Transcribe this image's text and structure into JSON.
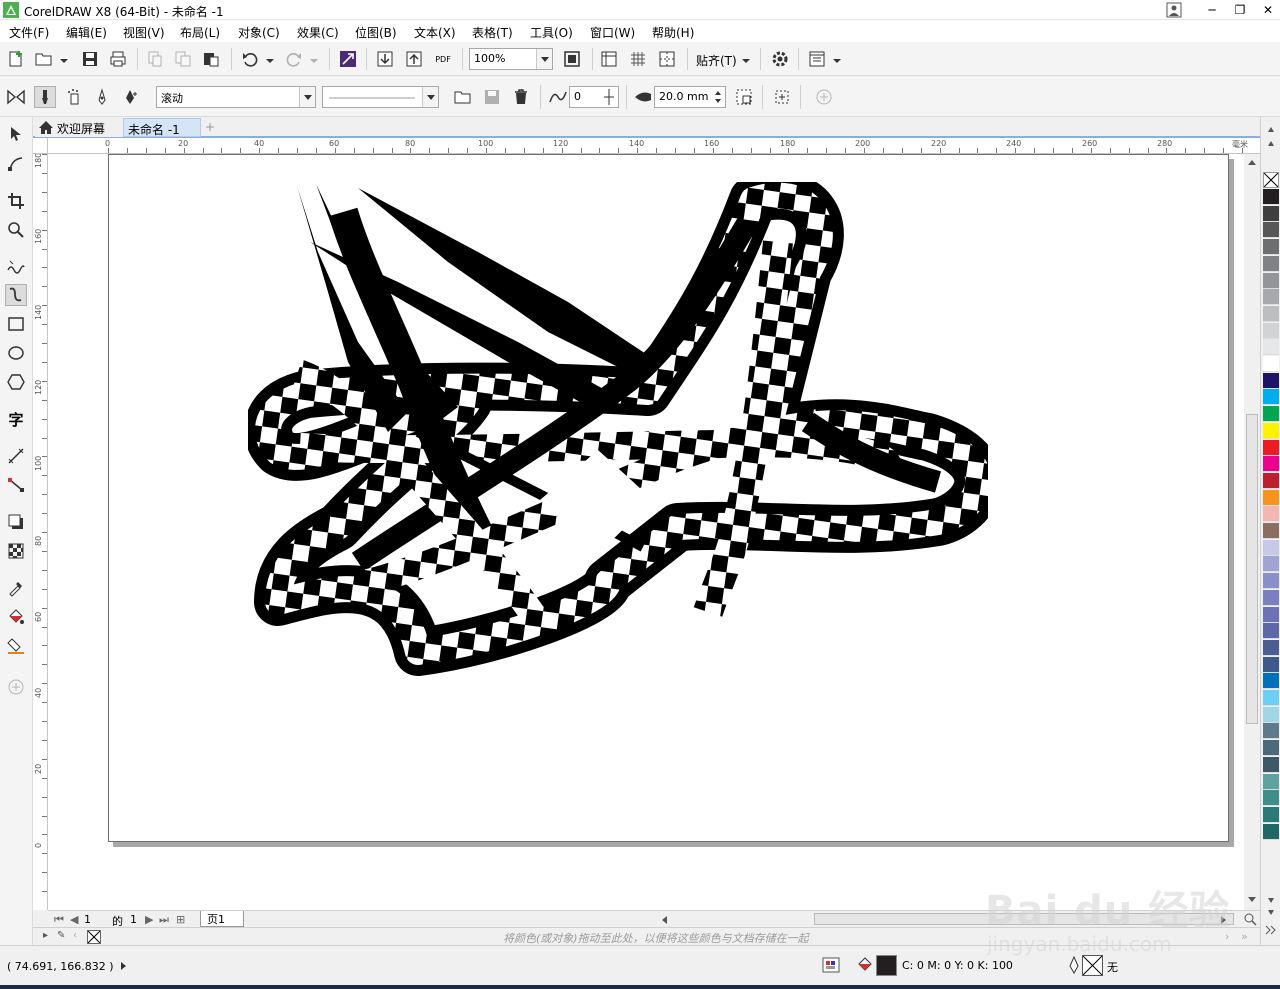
{
  "window": {
    "title": "CorelDRAW X8 (64-Bit) - 未命名 -1",
    "controls": {
      "minimize": "─",
      "restore": "❐",
      "close": "✕"
    }
  },
  "menubar": {
    "items": [
      "文件(F)",
      "编辑(E)",
      "视图(V)",
      "布局(L)",
      "对象(C)",
      "效果(C)",
      "位图(B)",
      "文本(X)",
      "表格(T)",
      "工具(O)",
      "窗口(W)",
      "帮助(H)"
    ]
  },
  "standard_toolbar": {
    "zoom_value": "100%",
    "snap_label": "贴齐(T)",
    "pdf_label": "PDF"
  },
  "property_bar": {
    "brush_type": "滚动",
    "stroke_preset": "",
    "smoothing_value": "0",
    "nib_size": "20.0 mm"
  },
  "tabs": {
    "welcome": "欢迎屏幕",
    "document": "未命名 -1",
    "add": "+"
  },
  "rulers": {
    "unit": "毫米",
    "h_labels": [
      "0",
      "20",
      "40",
      "60",
      "80",
      "100",
      "120",
      "140",
      "160",
      "180",
      "200",
      "220",
      "240",
      "260",
      "280"
    ],
    "v_labels": [
      "180",
      "160",
      "140",
      "120",
      "100",
      "80",
      "60",
      "40",
      "20",
      "0"
    ]
  },
  "page_nav": {
    "current": "1",
    "of_label": "的",
    "total": "1",
    "page_tab": "页1"
  },
  "document_palette": {
    "hint": "将颜色(或对象)拖动至此处，以便将这些颜色与文档存储在一起"
  },
  "palette": {
    "colors": [
      "#231f20",
      "#3f3f3f",
      "#575757",
      "#6d6e70",
      "#808285",
      "#939598",
      "#a7a9ac",
      "#bcbec0",
      "#d1d3d4",
      "#e6e7e8",
      "#ffffff",
      "#1b1464",
      "#00aeef",
      "#00a651",
      "#fff200",
      "#ed1c24",
      "#ec008c",
      "#be1e2d",
      "#f7941d",
      "#f4b6b1",
      "#8b6d62",
      "#c7c9e6",
      "#9fa4d4",
      "#8a8fc9",
      "#7a7fbf",
      "#6d72b4",
      "#5d68a8",
      "#4b5e93",
      "#3c5a8b",
      "#0072bc",
      "#6dcff6",
      "#a0d6e6",
      "#5e7b8b",
      "#4d6a7a",
      "#3d5968",
      "#5fa3a0",
      "#3d8f8c",
      "#2a7a78",
      "#1e6866"
    ]
  },
  "status": {
    "coordinates": "( 74.691, 166.832 )",
    "fill_label": "C: 0 M: 0 Y: 0 K: 100",
    "outline_label": "无",
    "fill_color": "#231f20"
  },
  "watermark": {
    "main": "Bai du 经验",
    "sub": "jingyan.baidu.com"
  }
}
